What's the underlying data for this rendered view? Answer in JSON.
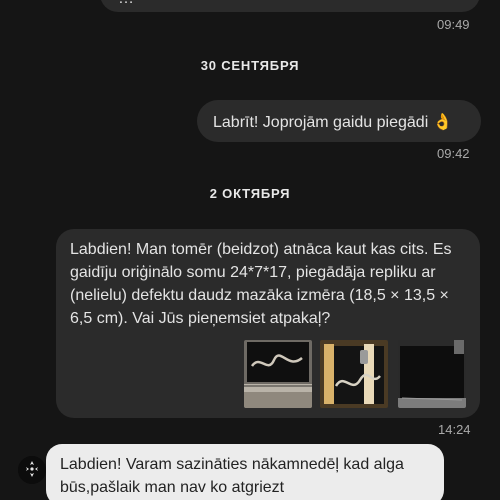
{
  "chat": {
    "top_message_partial": "…",
    "top_message_time": "09:49",
    "date_1": "30 СЕНТЯБРЯ",
    "msg_out_text": "Labrīt! Joprojām gaidu piegādi 👌",
    "msg_out_time": "09:42",
    "date_2": "2 ОКТЯБРЯ",
    "msg_long_text": "Labdien! Man tomēr (beidzot) atnāca kaut kas cits. Es gaidīju oriģinālo somu 24*7*17, piegādāja repliku ar (nelielu) defektu daudz mazāka izmēra (18,5 × 13,5 × 6,5 cm). Vai Jūs pieņemsiet atpakaļ?",
    "msg_long_time": "14:24",
    "thumbnails": [
      {
        "icon": "photo-black-bag-logo"
      },
      {
        "icon": "photo-bag-ruler"
      },
      {
        "icon": "photo-black-leather"
      }
    ],
    "msg_in_text": "Labdien! Varam sazināties nākamnedēļ kad alga būs,pašlaik man nav ko atgriezt",
    "avatar_icon": "seller-avatar-icon"
  }
}
